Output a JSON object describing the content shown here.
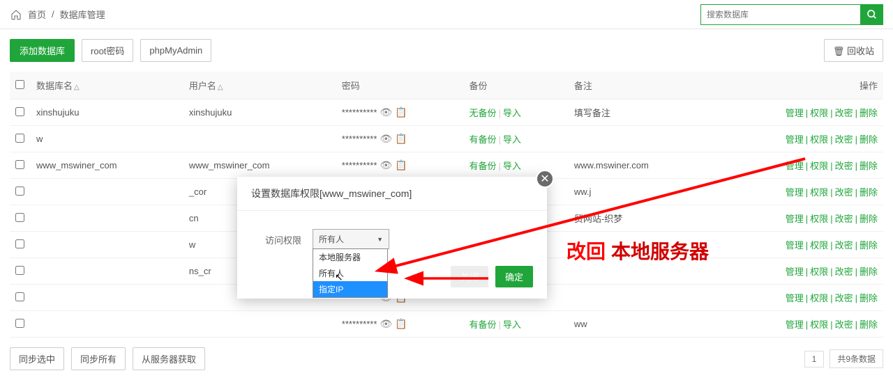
{
  "breadcrumb": {
    "home": "首页",
    "sep": "/",
    "current": "数据库管理"
  },
  "search": {
    "placeholder": "搜索数据库"
  },
  "toolbar": {
    "add_db": "添加数据库",
    "root_pwd": "root密码",
    "phpmyadmin": "phpMyAdmin",
    "recycle": "回收站"
  },
  "table_header": {
    "name": "数据库名",
    "user": "用户名",
    "pwd": "密码",
    "backup": "备份",
    "note": "备注",
    "ops": "操作"
  },
  "masked_pwd": "**********",
  "backup_none": "无备份",
  "backup_has": "有备份",
  "backup_import": "导入",
  "actions": {
    "manage": "管理",
    "perm": "权限",
    "chpwd": "改密",
    "del": "删除"
  },
  "rows": [
    {
      "name": "xinshujuku",
      "user": "xinshujuku",
      "backup": "none",
      "note": "填写备注"
    },
    {
      "name": "w",
      "user": "",
      "backup": "has",
      "note": ""
    },
    {
      "name": "www_mswiner_com",
      "user": "www_mswiner_com",
      "backup": "has",
      "note": "www.mswiner.com"
    },
    {
      "name": "",
      "user": "_cor",
      "backup": "",
      "note": "ww.j"
    },
    {
      "name": "",
      "user": "cn",
      "backup": "",
      "note": "贸网站-织梦"
    },
    {
      "name": "",
      "user": "w",
      "backup": "",
      "note": ""
    },
    {
      "name": "",
      "user": "ns_cr",
      "backup": "",
      "note": ""
    },
    {
      "name": "",
      "user": "",
      "backup": "",
      "note": ""
    },
    {
      "name": "",
      "user": "",
      "backup": "has",
      "note": "ww"
    }
  ],
  "bottom": {
    "sync_sel": "同步选中",
    "sync_all": "同步所有",
    "from_server": "从服务器获取",
    "page": "1",
    "total": "共9条数据"
  },
  "modal": {
    "title": "设置数据库权限[www_mswiner_com]",
    "field_label": "访问权限",
    "selected": "所有人",
    "options": [
      "本地服务器",
      "所有人",
      "指定IP"
    ],
    "cancel": "关闭",
    "confirm": "确定"
  },
  "annotation": {
    "t1": "改回",
    "t2": "本地服务器"
  }
}
